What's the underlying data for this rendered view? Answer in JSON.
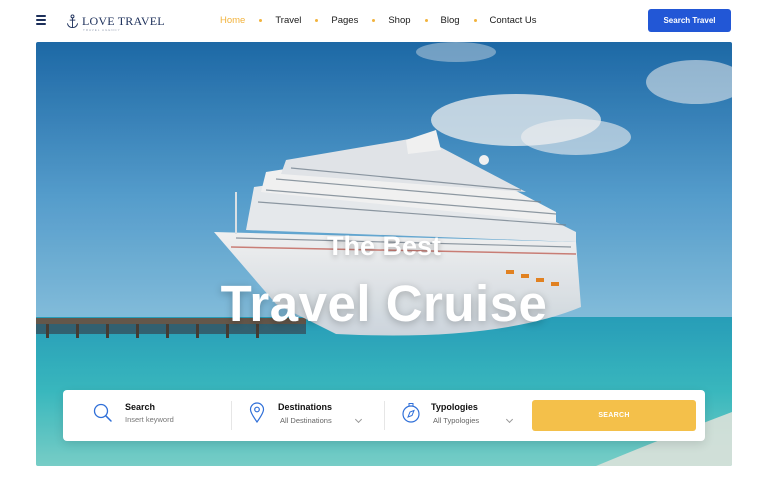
{
  "header": {
    "logo_text": "LOVE TRAVEL",
    "logo_tagline": "TRAVEL AGENCY",
    "nav": [
      {
        "label": "Home",
        "active": true
      },
      {
        "label": "Travel",
        "active": false
      },
      {
        "label": "Pages",
        "active": false
      },
      {
        "label": "Shop",
        "active": false
      },
      {
        "label": "Blog",
        "active": false
      },
      {
        "label": "Contact Us",
        "active": false
      }
    ],
    "cta_label": "Search Travel"
  },
  "hero": {
    "subtitle": "The Best",
    "title": "Travel Cruise"
  },
  "search": {
    "keyword": {
      "label": "Search",
      "placeholder": "Insert keyword",
      "icon": "search-icon"
    },
    "destinations": {
      "label": "Destinations",
      "value": "All Destinations",
      "icon": "map-pin-icon"
    },
    "typologies": {
      "label": "Typologies",
      "value": "All Typologies",
      "icon": "compass-icon"
    },
    "button_label": "SEARCH"
  },
  "colors": {
    "accent": "#f2b33d",
    "primary": "#2257d6",
    "search_button": "#f4c04a",
    "brand": "#1c2f5a"
  }
}
